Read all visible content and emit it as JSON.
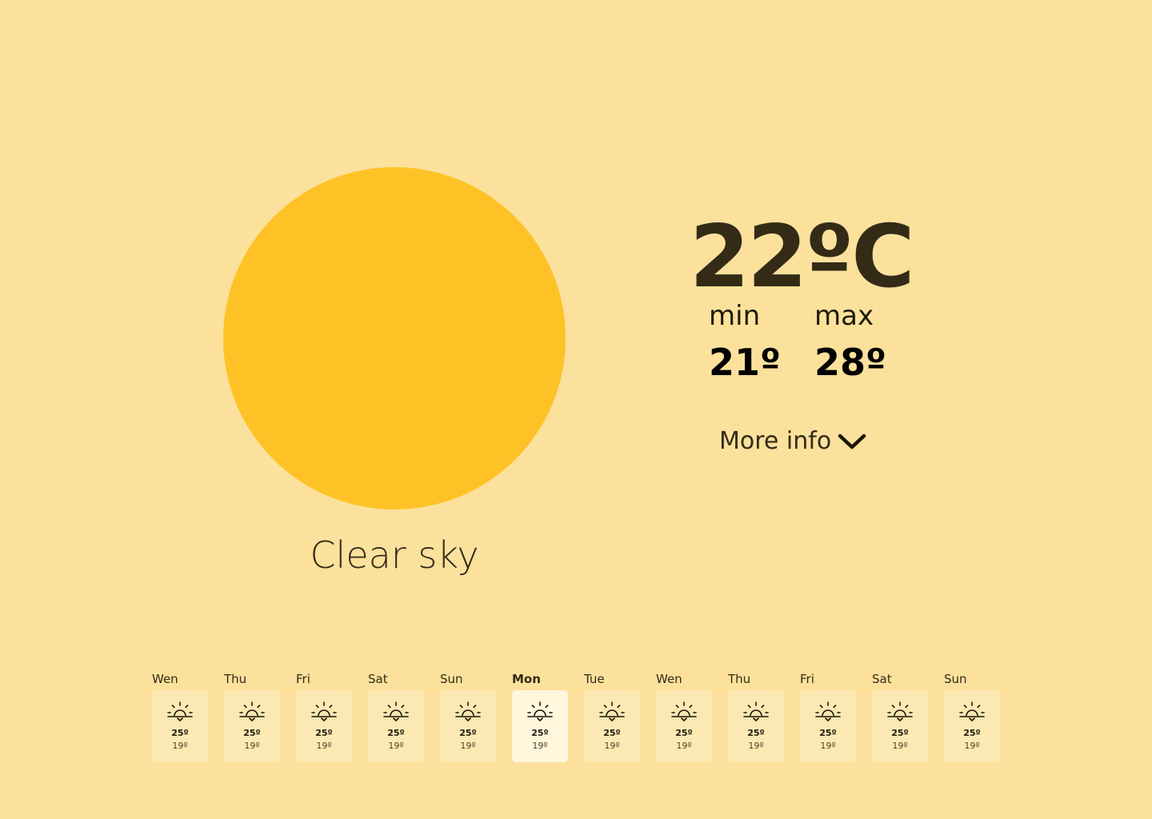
{
  "current": {
    "condition": "Clear sky",
    "temperature": "22ºC",
    "min_label": "min",
    "min_value": "21º",
    "max_label": "max",
    "max_value": "28º"
  },
  "more_info": {
    "label": "More info",
    "icon": "chevron-down-icon"
  },
  "forecast": [
    {
      "day": "Wen",
      "high": "25º",
      "low": "19º",
      "icon": "sunrise-icon",
      "active": false
    },
    {
      "day": "Thu",
      "high": "25º",
      "low": "19º",
      "icon": "sunrise-icon",
      "active": false
    },
    {
      "day": "Fri",
      "high": "25º",
      "low": "19º",
      "icon": "sunrise-icon",
      "active": false
    },
    {
      "day": "Sat",
      "high": "25º",
      "low": "19º",
      "icon": "sunrise-icon",
      "active": false
    },
    {
      "day": "Sun",
      "high": "25º",
      "low": "19º",
      "icon": "sunrise-icon",
      "active": false
    },
    {
      "day": "Mon",
      "high": "25º",
      "low": "19º",
      "icon": "sunrise-icon",
      "active": true
    },
    {
      "day": "Tue",
      "high": "25º",
      "low": "19º",
      "icon": "sunrise-icon",
      "active": false
    },
    {
      "day": "Wen",
      "high": "25º",
      "low": "19º",
      "icon": "sunrise-icon",
      "active": false
    },
    {
      "day": "Thu",
      "high": "25º",
      "low": "19º",
      "icon": "sunrise-icon",
      "active": false
    },
    {
      "day": "Fri",
      "high": "25º",
      "low": "19º",
      "icon": "sunrise-icon",
      "active": false
    },
    {
      "day": "Sat",
      "high": "25º",
      "low": "19º",
      "icon": "sunrise-icon",
      "active": false
    },
    {
      "day": "Sun",
      "high": "25º",
      "low": "19º",
      "icon": "sunrise-icon",
      "active": false
    }
  ],
  "colors": {
    "background": "#fbe19c",
    "sun": "#ffc226",
    "card": "#fce8b2",
    "card_active": "#fff6dc",
    "text": "#332b16"
  }
}
